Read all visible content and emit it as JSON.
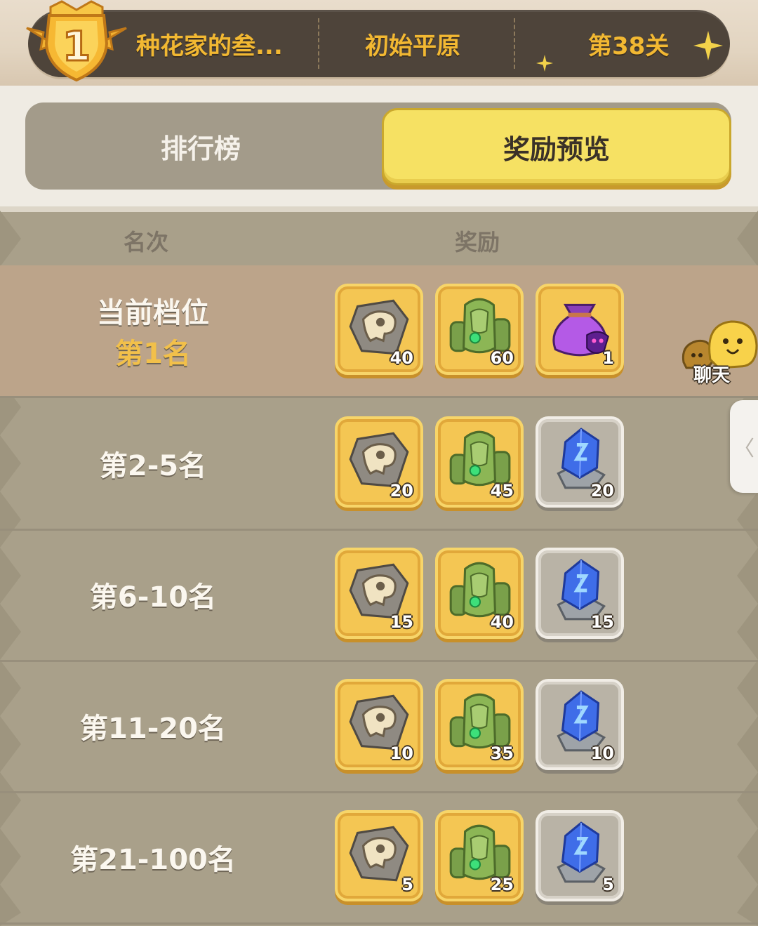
{
  "header": {
    "rank_number": "1",
    "player_name": "种花家的叁...",
    "region": "初始平原",
    "level": "第38关"
  },
  "tabs": [
    {
      "label": "排行榜",
      "active": false
    },
    {
      "label": "奖励预览",
      "active": true
    }
  ],
  "columns": {
    "rank": "名次",
    "reward": "奖励"
  },
  "rows": [
    {
      "title": "当前档位",
      "subtitle": "第1名",
      "current": true,
      "rewards": [
        {
          "icon": "fossil-icon",
          "count": "40",
          "frame": "gold"
        },
        {
          "icon": "stone-golem-icon",
          "count": "60",
          "frame": "gold"
        },
        {
          "icon": "treasure-bag-icon",
          "count": "1",
          "frame": "gold"
        }
      ]
    },
    {
      "title": "第2-5名",
      "subtitle": "",
      "current": false,
      "rewards": [
        {
          "icon": "fossil-icon",
          "count": "20",
          "frame": "gold"
        },
        {
          "icon": "stone-golem-icon",
          "count": "45",
          "frame": "gold"
        },
        {
          "icon": "blue-crystal-icon",
          "count": "20",
          "frame": "silver"
        }
      ]
    },
    {
      "title": "第6-10名",
      "subtitle": "",
      "current": false,
      "rewards": [
        {
          "icon": "fossil-icon",
          "count": "15",
          "frame": "gold"
        },
        {
          "icon": "stone-golem-icon",
          "count": "40",
          "frame": "gold"
        },
        {
          "icon": "blue-crystal-icon",
          "count": "15",
          "frame": "silver"
        }
      ]
    },
    {
      "title": "第11-20名",
      "subtitle": "",
      "current": false,
      "rewards": [
        {
          "icon": "fossil-icon",
          "count": "10",
          "frame": "gold"
        },
        {
          "icon": "stone-golem-icon",
          "count": "35",
          "frame": "gold"
        },
        {
          "icon": "blue-crystal-icon",
          "count": "10",
          "frame": "silver"
        }
      ]
    },
    {
      "title": "第21-100名",
      "subtitle": "",
      "current": false,
      "rewards": [
        {
          "icon": "fossil-icon",
          "count": "5",
          "frame": "gold"
        },
        {
          "icon": "stone-golem-icon",
          "count": "25",
          "frame": "gold"
        },
        {
          "icon": "blue-crystal-icon",
          "count": "5",
          "frame": "silver"
        }
      ]
    }
  ],
  "chat": {
    "label": "聊天"
  },
  "side_tab": {
    "glyph": "〈"
  },
  "colors": {
    "accent": "#f2b832",
    "tab_active": "#f6e163",
    "current_row": "#bca48a"
  }
}
